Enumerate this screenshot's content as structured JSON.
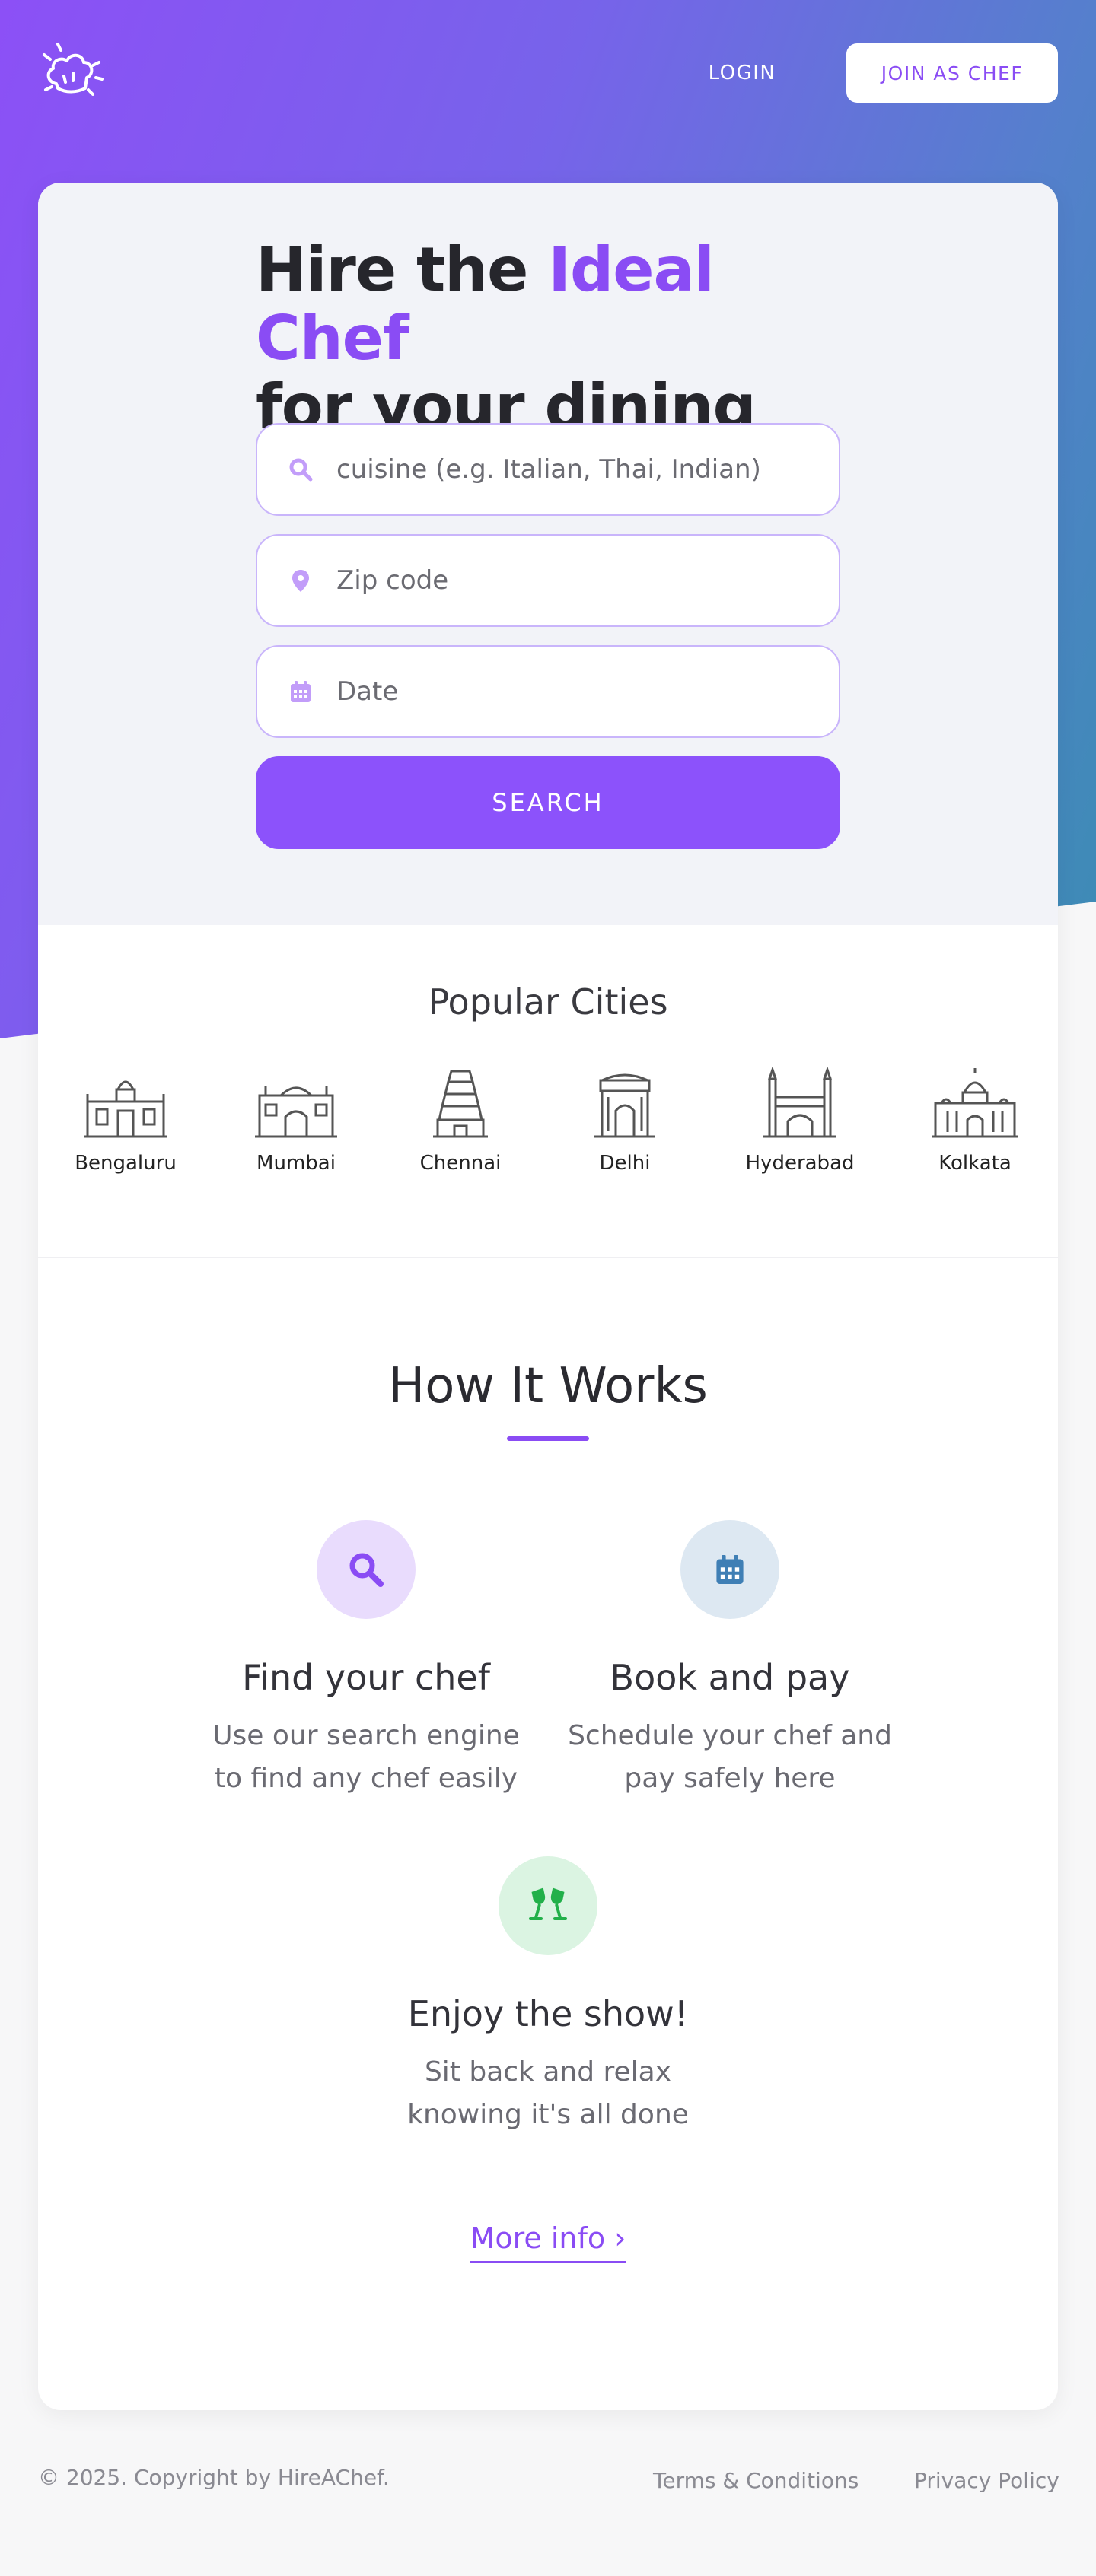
{
  "header": {
    "login_label": "LOGIN",
    "join_label": "JOIN AS CHEF"
  },
  "hero": {
    "title_part1": "Hire the ",
    "title_accent": "Ideal Chef",
    "title_part2": "for your dining",
    "cuisine_placeholder": "cuisine (e.g. Italian, Thai, Indian)",
    "zip_placeholder": "Zip code",
    "date_placeholder": "Date",
    "search_label": "SEARCH"
  },
  "cities": {
    "title": "Popular Cities",
    "items": [
      "Bengaluru",
      "Mumbai",
      "Chennai",
      "Delhi",
      "Hyderabad",
      "Kolkata"
    ]
  },
  "how_it_works": {
    "title": "How It Works",
    "steps": [
      {
        "title": "Find your chef",
        "desc_line1": "Use our search engine",
        "desc_line2": "to find any chef easily",
        "icon": "search-icon",
        "color": "#8a4cf4",
        "bg": "#e9dcfd"
      },
      {
        "title": "Book and pay",
        "desc_line1": "Schedule your chef and",
        "desc_line2": "pay safely here",
        "icon": "calendar-icon",
        "color": "#3f7fb5",
        "bg": "#dde8f2"
      },
      {
        "title": "Enjoy the show!",
        "desc_line1": "Sit back and relax",
        "desc_line2": "knowing it's all done",
        "icon": "cheers-icon",
        "color": "#22b04a",
        "bg": "#dbf4e2"
      }
    ],
    "more_info": "More info ›"
  },
  "footer": {
    "copyright": "© 2025. Copyright by HireAChef.",
    "terms": "Terms & Conditions",
    "privacy": "Privacy Policy"
  },
  "colors": {
    "accent": "#8a4cf4",
    "button": "#8c52fb"
  }
}
